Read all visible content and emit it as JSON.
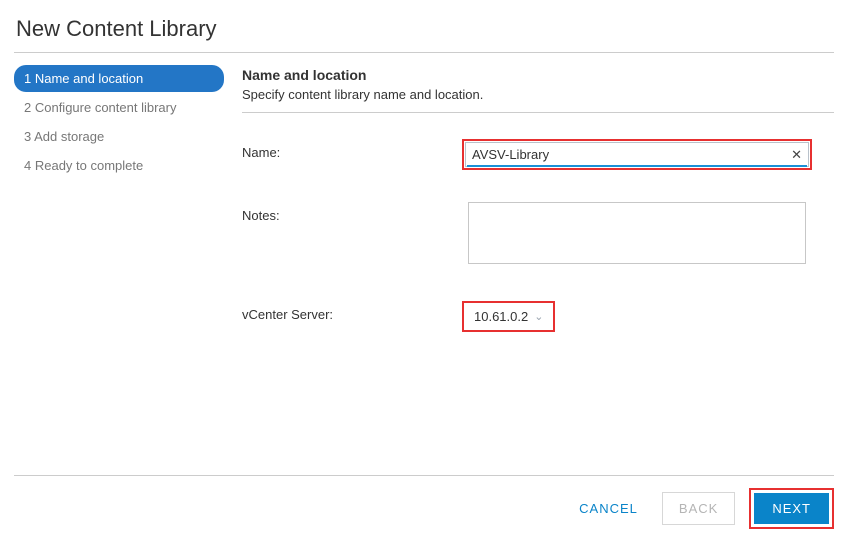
{
  "title": "New Content Library",
  "steps": [
    {
      "label": "1 Name and location",
      "active": true
    },
    {
      "label": "2 Configure content library",
      "active": false
    },
    {
      "label": "3 Add storage",
      "active": false
    },
    {
      "label": "4 Ready to complete",
      "active": false
    }
  ],
  "section": {
    "title": "Name and location",
    "subtitle": "Specify content library name and location."
  },
  "form": {
    "name_label": "Name:",
    "name_value": "AVSV-Library",
    "notes_label": "Notes:",
    "notes_value": "",
    "vcenter_label": "vCenter Server:",
    "vcenter_value": "10.61.0.2"
  },
  "buttons": {
    "cancel": "CANCEL",
    "back": "BACK",
    "next": "NEXT"
  }
}
